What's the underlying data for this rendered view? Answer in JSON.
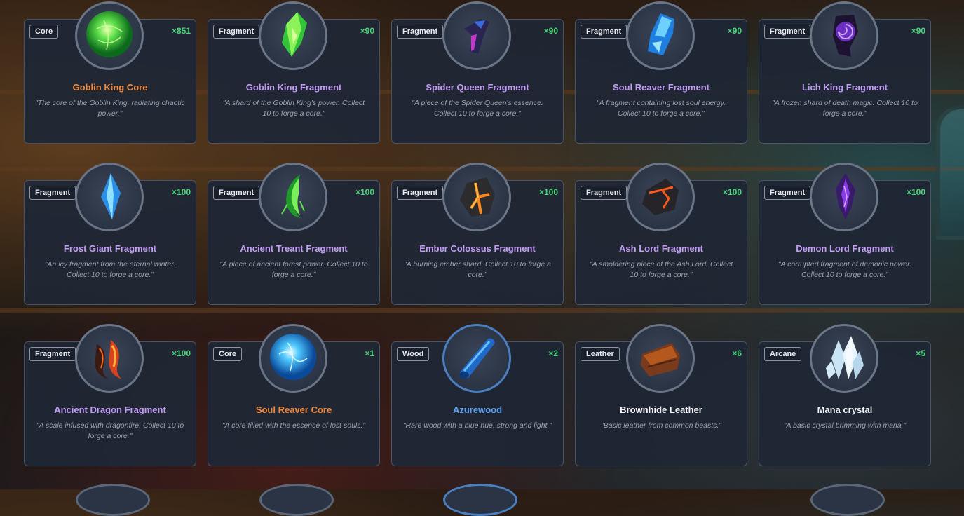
{
  "inventory": {
    "items": [
      {
        "tag": "Core",
        "qty": "×851",
        "name": "Goblin King Core",
        "rarity": "orange",
        "icon": "goblin-king-core-icon",
        "desc": "\"The core of the Goblin King, radiating chaotic power.\""
      },
      {
        "tag": "Fragment",
        "qty": "×90",
        "name": "Goblin King Fragment",
        "rarity": "purple",
        "icon": "goblin-king-fragment-icon",
        "desc": "\"A shard of the Goblin King's power. Collect 10 to forge a core.\""
      },
      {
        "tag": "Fragment",
        "qty": "×90",
        "name": "Spider Queen Fragment",
        "rarity": "purple",
        "icon": "spider-queen-fragment-icon",
        "desc": "\"A piece of the Spider Queen's essence. Collect 10 to forge a core.\""
      },
      {
        "tag": "Fragment",
        "qty": "×90",
        "name": "Soul Reaver Fragment",
        "rarity": "purple",
        "icon": "soul-reaver-fragment-icon",
        "desc": "\"A fragment containing lost soul energy. Collect 10 to forge a core.\""
      },
      {
        "tag": "Fragment",
        "qty": "×90",
        "name": "Lich King Fragment",
        "rarity": "purple",
        "icon": "lich-king-fragment-icon",
        "desc": "\"A frozen shard of death magic. Collect 10 to forge a core.\""
      },
      {
        "tag": "Fragment",
        "qty": "×100",
        "name": "Frost Giant Fragment",
        "rarity": "purple",
        "icon": "frost-giant-fragment-icon",
        "desc": "\"An icy fragment from the eternal winter. Collect 10 to forge a core.\""
      },
      {
        "tag": "Fragment",
        "qty": "×100",
        "name": "Ancient Treant Fragment",
        "rarity": "purple",
        "icon": "ancient-treant-fragment-icon",
        "desc": "\"A piece of ancient forest power. Collect 10 to forge a core.\""
      },
      {
        "tag": "Fragment",
        "qty": "×100",
        "name": "Ember Colossus Fragment",
        "rarity": "purple",
        "icon": "ember-colossus-fragment-icon",
        "desc": "\"A burning ember shard. Collect 10 to forge a core.\""
      },
      {
        "tag": "Fragment",
        "qty": "×100",
        "name": "Ash Lord Fragment",
        "rarity": "purple",
        "icon": "ash-lord-fragment-icon",
        "desc": "\"A smoldering piece of the Ash Lord. Collect 10 to forge a core.\""
      },
      {
        "tag": "Fragment",
        "qty": "×100",
        "name": "Demon Lord Fragment",
        "rarity": "purple",
        "icon": "demon-lord-fragment-icon",
        "desc": "\"A corrupted fragment of demonic power. Collect 10 to forge a core.\""
      },
      {
        "tag": "Fragment",
        "qty": "×100",
        "name": "Ancient Dragon Fragment",
        "rarity": "purple",
        "icon": "ancient-dragon-fragment-icon",
        "desc": "\"A scale infused with dragonfire. Collect 10 to forge a core.\""
      },
      {
        "tag": "Core",
        "qty": "×1",
        "name": "Soul Reaver Core",
        "rarity": "orange",
        "icon": "soul-reaver-core-icon",
        "desc": "\"A core filled with the essence of lost souls.\""
      },
      {
        "tag": "Wood",
        "qty": "×2",
        "name": "Azurewood",
        "rarity": "blue",
        "icon": "azurewood-icon",
        "desc": "\"Rare wood with a blue hue, strong and light.\""
      },
      {
        "tag": "Leather",
        "qty": "×6",
        "name": "Brownhide Leather",
        "rarity": "white",
        "icon": "brownhide-leather-icon",
        "desc": "\"Basic leather from common beasts.\""
      },
      {
        "tag": "Arcane",
        "qty": "×5",
        "name": "Mana crystal",
        "rarity": "white",
        "icon": "mana-crystal-icon",
        "desc": "\"A basic crystal brimming with mana.\""
      }
    ]
  },
  "colors": {
    "rare_orange": "#f08a3c",
    "epic_purple": "#c29cf5",
    "uncommon_blue": "#5fa3f0",
    "common_white": "#f2f4f7",
    "qty_green": "#48d67a"
  }
}
